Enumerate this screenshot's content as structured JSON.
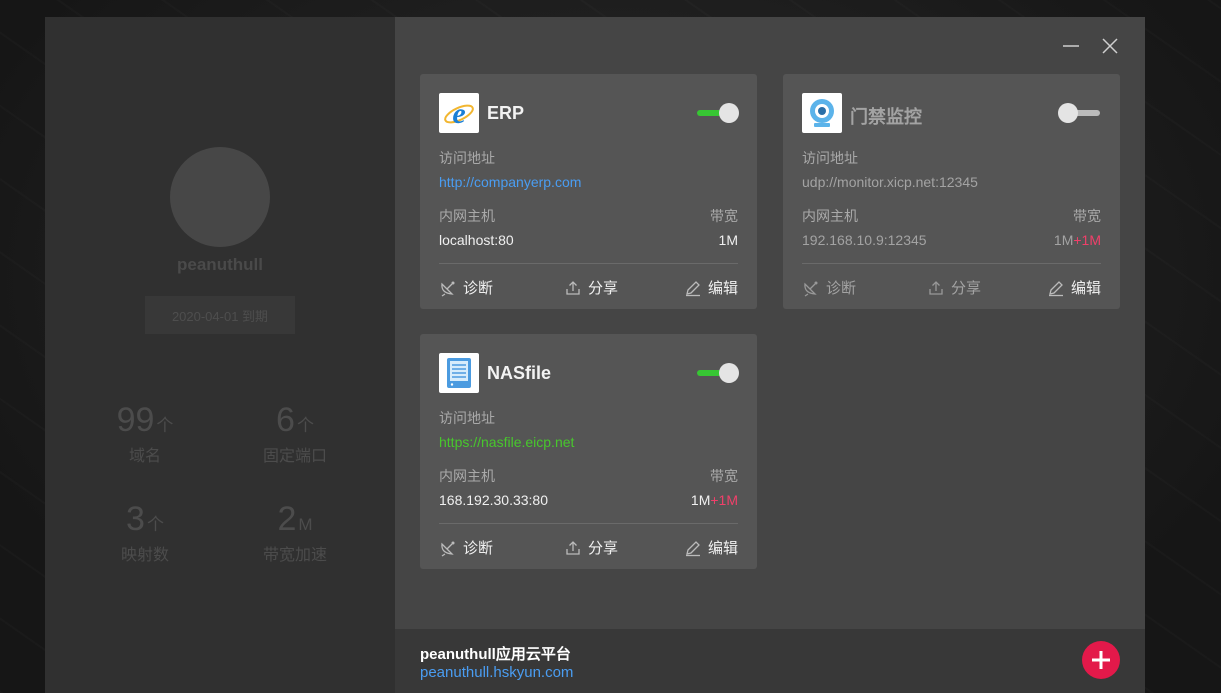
{
  "profile": {
    "username": "peanuthull",
    "expire": "2020-04-01 到期",
    "stats": [
      {
        "num": "99",
        "unit": "个",
        "label": "域名"
      },
      {
        "num": "6",
        "unit": "个",
        "label": "固定端口"
      },
      {
        "num": "3",
        "unit": "个",
        "label": "映射数"
      },
      {
        "num": "2",
        "unit": "M",
        "label": "带宽加速"
      }
    ]
  },
  "labels": {
    "address": "访问地址",
    "host": "内网主机",
    "bandwidth": "带宽",
    "diagnose": "诊断",
    "share": "分享",
    "edit": "编辑"
  },
  "cards": [
    {
      "name": "ERP",
      "enabled": true,
      "address": "http://companyerp.com",
      "host": "localhost:80",
      "bw": "1M",
      "bw_plus": "",
      "icon": "ie-icon"
    },
    {
      "name": "门禁监控",
      "enabled": false,
      "address": "udp://monitor.xicp.net:12345",
      "host": "192.168.10.9:12345",
      "bw": "1M",
      "bw_plus": "+1M",
      "icon": "webcam-icon"
    },
    {
      "name": "NASfile",
      "enabled": true,
      "address": "https://nasfile.eicp.net",
      "host": "168.192.30.33:80",
      "bw": "1M",
      "bw_plus": "+1M",
      "icon": "nas-server-icon"
    }
  ],
  "footer": {
    "title": "peanuthull应用云平台",
    "link": "peanuthull.hskyun.com"
  },
  "colors": {
    "accent_green": "#37c633",
    "link_blue": "#4a9df2",
    "link_green": "#48c72d",
    "plus_red": "#f0406a",
    "add_button": "#e3194a"
  }
}
